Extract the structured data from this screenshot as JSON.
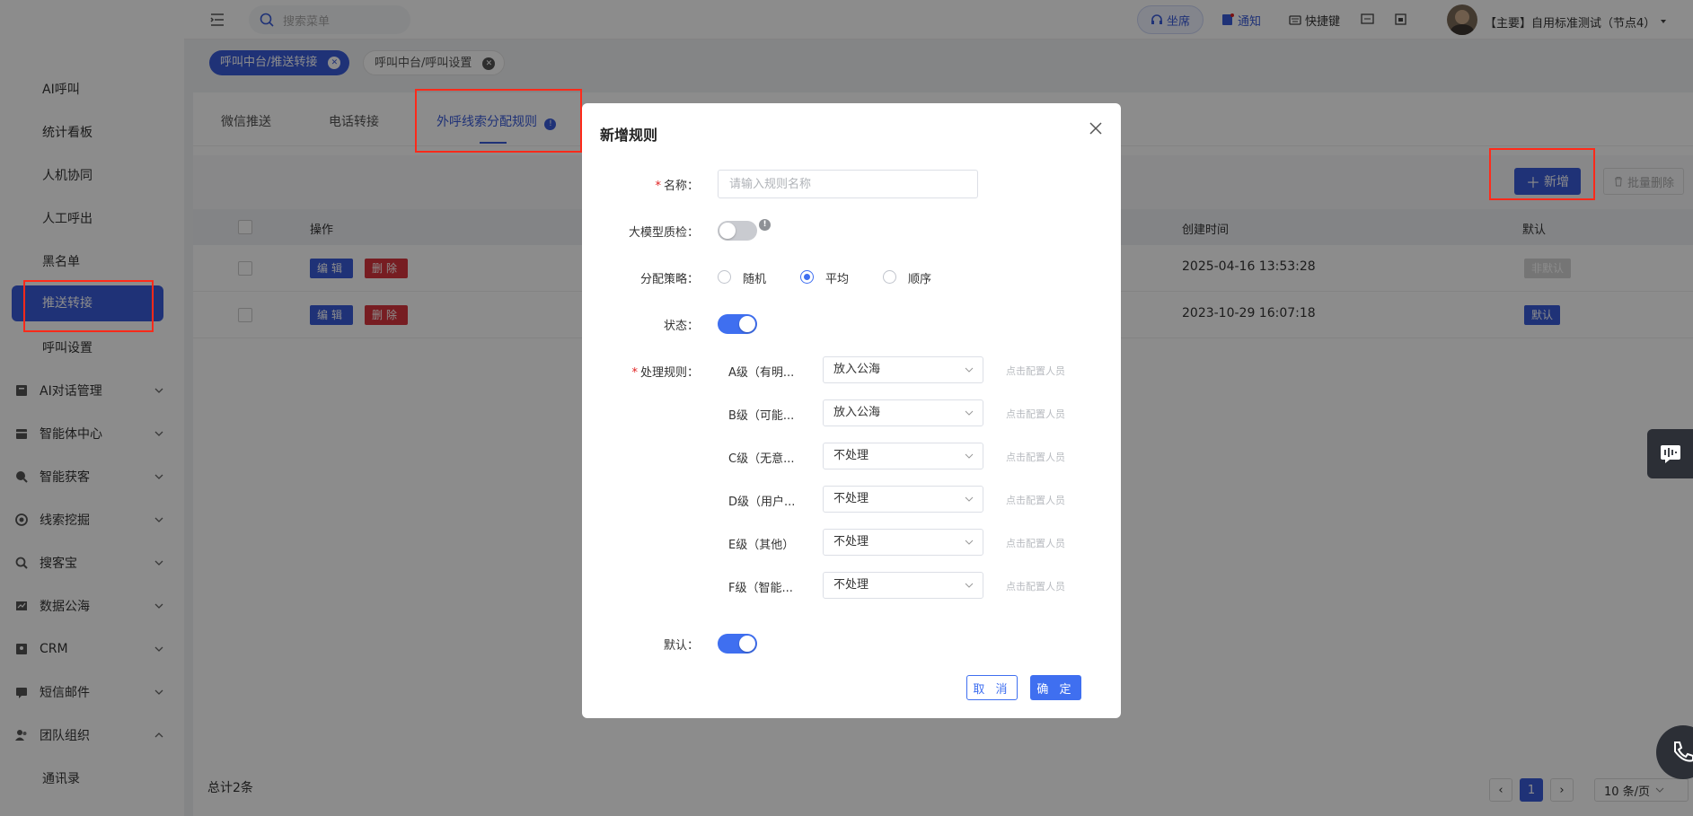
{
  "search": {
    "placeholder": "搜索菜单"
  },
  "topbar": {
    "seat": "坐席",
    "notify": "通知",
    "shortcut": "快捷键",
    "user": "【主要】自用标准测试（节点4）"
  },
  "page_tabs": [
    {
      "label": "呼叫中台/推送转接",
      "active": true
    },
    {
      "label": "呼叫中台/呼叫设置",
      "active": false
    }
  ],
  "sidebar": {
    "items": [
      "AI呼叫",
      "统计看板",
      "人机协同",
      "人工呼出",
      "黑名单"
    ],
    "active": "推送转接",
    "after_active": "呼叫设置",
    "groups": [
      {
        "label": "AI对话管理",
        "icon": "book-icon",
        "expanded": false
      },
      {
        "label": "智能体中心",
        "icon": "box-icon",
        "expanded": false
      },
      {
        "label": "智能获客",
        "icon": "search-person-icon",
        "expanded": false
      },
      {
        "label": "线索挖掘",
        "icon": "target-icon",
        "expanded": false
      },
      {
        "label": "搜客宝",
        "icon": "magnifier-icon",
        "expanded": false
      },
      {
        "label": "数据公海",
        "icon": "chart-icon",
        "expanded": false
      },
      {
        "label": "CRM",
        "icon": "contact-icon",
        "expanded": false
      },
      {
        "label": "短信邮件",
        "icon": "message-icon",
        "expanded": false
      },
      {
        "label": "团队组织",
        "icon": "team-icon",
        "expanded": true
      }
    ],
    "sub_item": "通讯录"
  },
  "subtabs": [
    "微信推送",
    "电话转接",
    "外呼线索分配规则"
  ],
  "toolbar": {
    "new_label": "新增",
    "batch_delete_label": "批量删除"
  },
  "table": {
    "headers": {
      "op": "操作",
      "created": "创建时间",
      "default": "默认"
    },
    "edit_label": "编辑",
    "delete_label": "删除",
    "rows": [
      {
        "created": "2025-04-16 13:53:28",
        "default_label": "非默认",
        "is_default": false
      },
      {
        "created": "2023-10-29 16:07:18",
        "default_label": "默认",
        "is_default": true
      }
    ]
  },
  "footer": {
    "total": "总计2条",
    "page": "1",
    "page_size": "10 条/页"
  },
  "modal": {
    "title": "新增规则",
    "name_label": "名称：",
    "name_placeholder": "请输入规则名称",
    "qc_label": "大模型质检：",
    "qc_on": false,
    "strategy_label": "分配策略：",
    "strategy_options": [
      "随机",
      "平均",
      "顺序"
    ],
    "strategy_selected": "平均",
    "status_label": "状态：",
    "status_on": true,
    "rules_label": "处理规则：",
    "rules": [
      {
        "name": "A级（有明...",
        "action": "放入公海",
        "config": "点击配置人员"
      },
      {
        "name": "B级（可能...",
        "action": "放入公海",
        "config": "点击配置人员"
      },
      {
        "name": "C级（无意...",
        "action": "不处理",
        "config": "点击配置人员"
      },
      {
        "name": "D级（用户...",
        "action": "不处理",
        "config": "点击配置人员"
      },
      {
        "name": "E级（其他）",
        "action": "不处理",
        "config": "点击配置人员"
      },
      {
        "name": "F级（智能...",
        "action": "不处理",
        "config": "点击配置人员"
      }
    ],
    "default_label": "默认：",
    "default_on": true,
    "cancel_label": "取 消",
    "ok_label": "确 定"
  },
  "colors": {
    "primary": "#3f6ff0",
    "sidebar_active": "#3a5bd9",
    "danger": "#e02020",
    "highlight_box": "#ff2a1a"
  }
}
